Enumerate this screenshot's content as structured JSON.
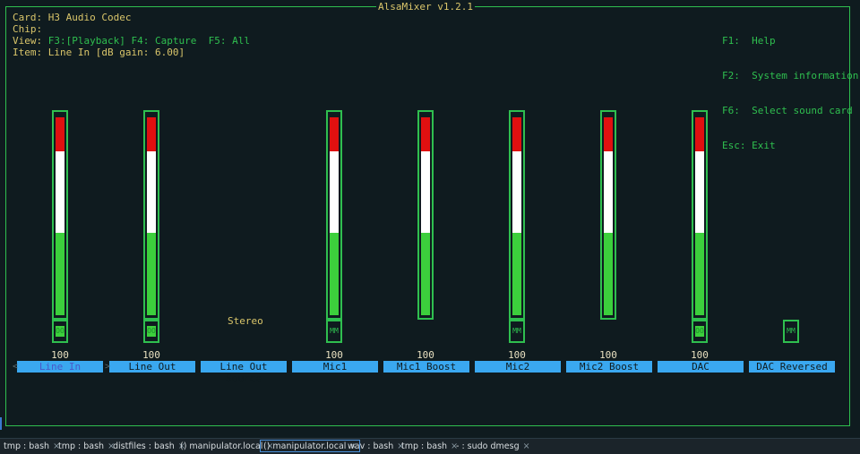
{
  "title": "AlsaMixer v1.2.1",
  "info": {
    "card_label": "Card:",
    "card_value": "H3 Audio Codec",
    "chip_label": "Chip:",
    "chip_value": "",
    "view_label": "View:",
    "view_f3": "F3:[Playback]",
    "view_f4": "F4: Capture",
    "view_f5": "F5: All",
    "item_label": "Item:",
    "item_value": "Line In [dB gain: 6.00]"
  },
  "help": [
    {
      "key": "F1:",
      "desc": "Help"
    },
    {
      "key": "F2:",
      "desc": "System information"
    },
    {
      "key": "F6:",
      "desc": "Select sound card"
    },
    {
      "key": "Esc:",
      "desc": "Exit"
    }
  ],
  "channels": [
    {
      "name": "Line In",
      "value": "100",
      "level": 1.0,
      "has_bar": true,
      "switch": "on",
      "switch_text": "OO",
      "selected": true
    },
    {
      "name": "Line Out",
      "value": "100",
      "level": 1.0,
      "has_bar": true,
      "switch": "on",
      "switch_text": "OO",
      "selected": false
    },
    {
      "name": "Line Out Source",
      "value": "",
      "level": 0,
      "has_bar": false,
      "switch": "none",
      "switch_text": "",
      "enum_value": "Stereo",
      "selected": false
    },
    {
      "name": "Mic1",
      "value": "100",
      "level": 1.0,
      "has_bar": true,
      "switch": "off",
      "switch_text": "MM",
      "selected": false
    },
    {
      "name": "Mic1 Boost",
      "value": "100",
      "level": 1.0,
      "has_bar": true,
      "switch": "none",
      "switch_text": "",
      "selected": false
    },
    {
      "name": "Mic2",
      "value": "100",
      "level": 1.0,
      "has_bar": true,
      "switch": "off",
      "switch_text": "MM",
      "selected": false
    },
    {
      "name": "Mic2 Boost",
      "value": "100",
      "level": 1.0,
      "has_bar": true,
      "switch": "none",
      "switch_text": "",
      "selected": false
    },
    {
      "name": "DAC",
      "value": "100",
      "level": 1.0,
      "has_bar": true,
      "switch": "on",
      "switch_text": "OO",
      "selected": false
    },
    {
      "name": "DAC Reversed",
      "value": "",
      "level": 0,
      "has_bar": false,
      "switch": "off",
      "switch_text": "MM",
      "selected": false
    }
  ],
  "nav_left": "<",
  "nav_right": ">",
  "tabs": [
    {
      "label": "tmp : bash",
      "close": "×",
      "active": false
    },
    {
      "label": "tmp : bash",
      "close": "×",
      "active": false
    },
    {
      "label": "distfiles : bash",
      "close": "×",
      "active": false
    },
    {
      "label": "() manipulator.local",
      "close": "×",
      "active": false
    },
    {
      "label": "() manipulator.local",
      "close": "×",
      "active": true
    },
    {
      "label": "wav : bash",
      "close": "×",
      "active": false
    },
    {
      "label": "tmp : bash",
      "close": "×",
      "active": false
    },
    {
      "label": "- : sudo dmesg",
      "close": "×",
      "active": false
    }
  ],
  "colors": {
    "frame": "#2fbf4f",
    "label_bg": "#3aa8f0",
    "title": "#d9c56a",
    "bg": "#0f1b1f"
  }
}
